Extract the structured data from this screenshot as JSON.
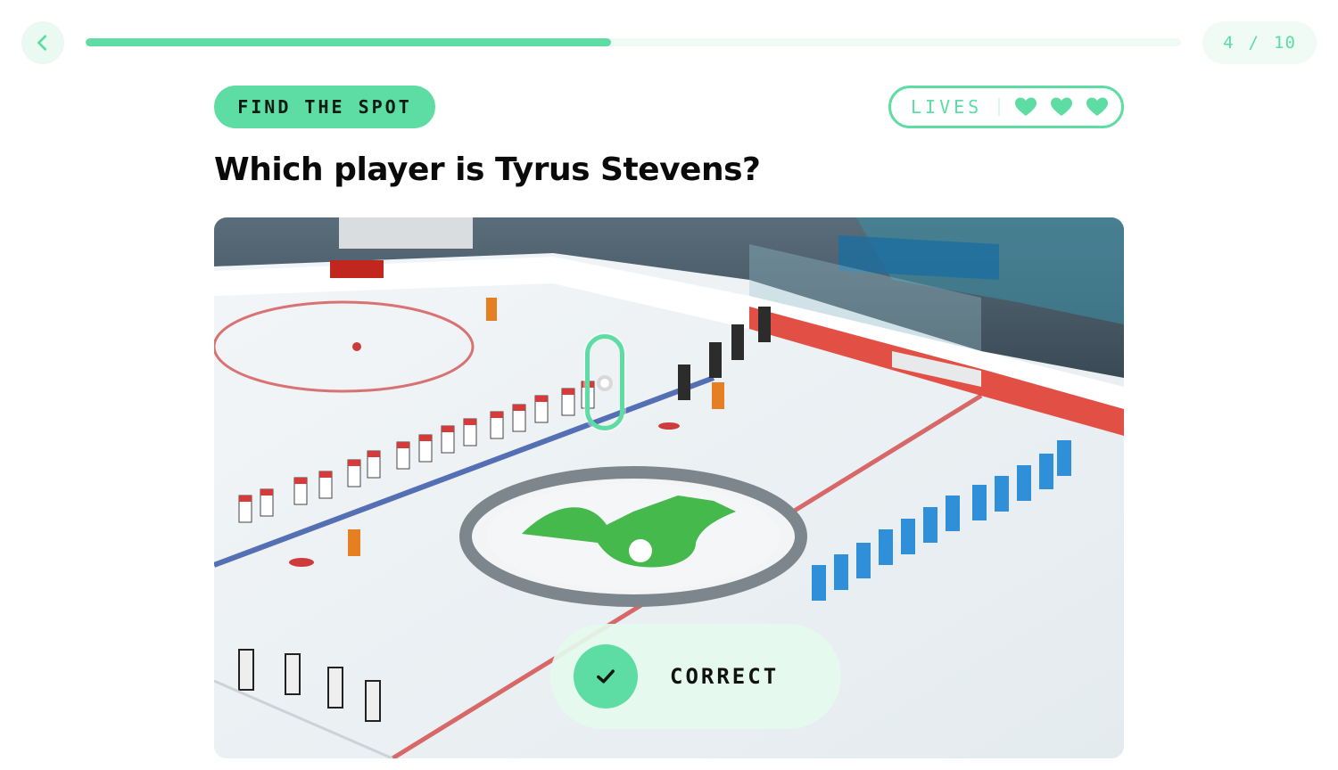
{
  "progress": {
    "current": "4",
    "separator": "/",
    "total": "10",
    "fraction": 0.4
  },
  "mode": {
    "label": "FIND THE SPOT"
  },
  "lives": {
    "label": "LIVES",
    "count": 3,
    "icon": "heart-icon"
  },
  "question": {
    "text": "Which player is Tyrus Stevens?"
  },
  "result": {
    "label": "CORRECT",
    "icon": "checkmark-icon"
  },
  "colors": {
    "accent": "#5ddca3",
    "accent_soft": "#eaf9f1",
    "text": "#0a0a0a"
  }
}
